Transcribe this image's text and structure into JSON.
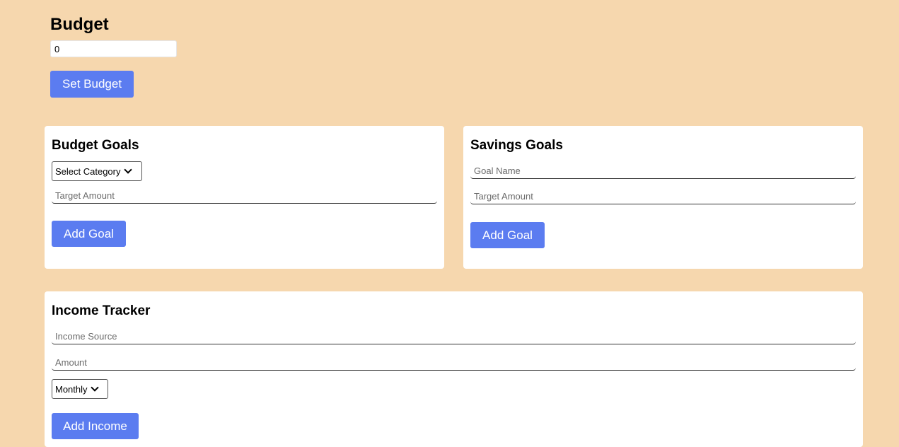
{
  "budget": {
    "title": "Budget",
    "input_value": "0",
    "set_button": "Set Budget"
  },
  "budget_goals": {
    "title": "Budget Goals",
    "category_select": "Select Category",
    "target_placeholder": "Target Amount",
    "add_button": "Add Goal"
  },
  "savings_goals": {
    "title": "Savings Goals",
    "name_placeholder": "Goal Name",
    "target_placeholder": "Target Amount",
    "add_button": "Add Goal"
  },
  "income_tracker": {
    "title": "Income Tracker",
    "source_placeholder": "Income Source",
    "amount_placeholder": "Amount",
    "frequency_select": "Monthly",
    "add_button": "Add Income"
  },
  "colors": {
    "background": "#f6d7ae",
    "button": "#5b7cf0",
    "card": "#ffffff"
  },
  "icons": {
    "select_arrow": "chevron-down-icon"
  }
}
